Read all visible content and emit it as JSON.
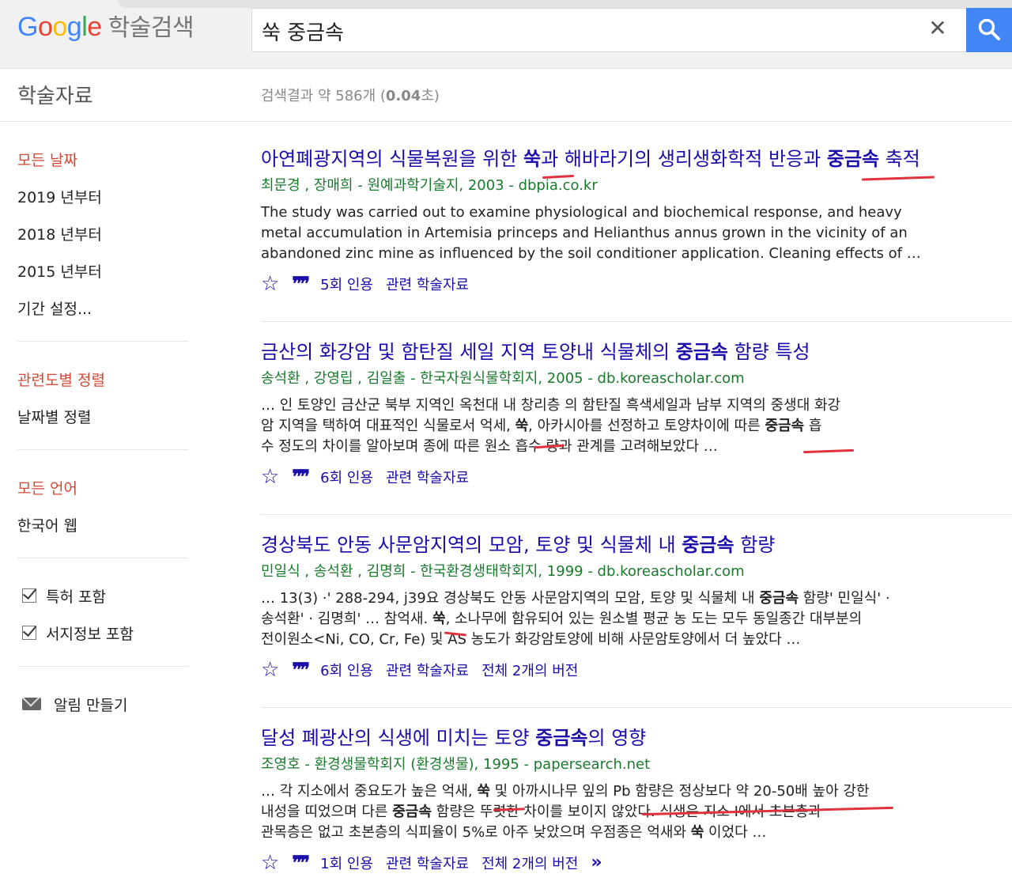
{
  "header": {
    "logo_letters": [
      "G",
      "o",
      "o",
      "g",
      "l",
      "e"
    ],
    "logo_suffix": "학술검색",
    "query": "쑥 중금속",
    "clear_icon": "✕",
    "search_icon": "search-icon"
  },
  "subbar": {
    "section_title": "학술자료",
    "stats_prefix": "검색결과 약 586개 (",
    "stats_time": "0.04",
    "stats_suffix": "초)"
  },
  "sidebar": {
    "date_filters": [
      "모든 날짜",
      "2019 년부터",
      "2018 년부터",
      "2015 년부터",
      "기간 설정..."
    ],
    "sort_options": [
      "관련도별 정렬",
      "날짜별 정렬"
    ],
    "language_options": [
      "모든 언어",
      "한국어 웹"
    ],
    "checkboxes": [
      "특허 포함",
      "서지정보 포함"
    ],
    "alert_label": "알림 만들기"
  },
  "results": [
    {
      "title": [
        {
          "t": "아연폐광지역의 식물복원을 위한 ",
          "b": false
        },
        {
          "t": "쑥",
          "b": true
        },
        {
          "t": "과 해바라기의 생리생화학적 반응과 ",
          "b": false
        },
        {
          "t": "중금속",
          "b": true
        },
        {
          "t": " 축적",
          "b": false
        }
      ],
      "meta": "최문경 ,  장매희 - 원예과학기술지, 2003 - dbpia.co.kr",
      "snippet": [
        [
          {
            "t": "The study was carried out to examine physiological and biochemical response, and heavy",
            "b": false
          }
        ],
        [
          {
            "t": "metal accumulation in Artemisia princeps and Helianthus annus grown in the vicinity of an",
            "b": false
          }
        ],
        [
          {
            "t": "abandoned zinc mine as influenced by the soil conditioner application. Cleaning effects of …",
            "b": false
          }
        ]
      ],
      "citations": "5회 인용",
      "related": "관련 학술자료",
      "versions": ""
    },
    {
      "title": [
        {
          "t": "금산의 화강암 및 함탄질 세일 지역 토양내 식물체의 ",
          "b": false
        },
        {
          "t": "중금속",
          "b": true
        },
        {
          "t": " 함량 특성",
          "b": false
        }
      ],
      "meta": "송석환 ,  강영립 ,  김일출 - 한국자원식물학회지, 2005 - db.koreascholar.com",
      "snippet": [
        [
          {
            "t": "… 인 토양인 금산군 북부 지역인 옥천대 내 창리층 의 함탄질 흑색세일과 남부 지역의 중생대 화강",
            "b": false
          }
        ],
        [
          {
            "t": "암 지역을 택하여 대표적인 식물로서 억세, ",
            "b": false
          },
          {
            "t": "쑥",
            "b": true
          },
          {
            "t": ", 아카시아를 선정하고 토양차이에 따른 ",
            "b": false
          },
          {
            "t": "중금속",
            "b": true
          },
          {
            "t": " 흡",
            "b": false
          }
        ],
        [
          {
            "t": "수 정도의 차이를 알아보며 종에 따른 원소 흡수 량과 관계를 고려해보았다 …",
            "b": false
          }
        ]
      ],
      "citations": "6회 인용",
      "related": "관련 학술자료",
      "versions": ""
    },
    {
      "title": [
        {
          "t": "경상북도 안동 사문암지역의 모암, 토양 및 식물체 내 ",
          "b": false
        },
        {
          "t": "중금속",
          "b": true
        },
        {
          "t": " 함량",
          "b": false
        }
      ],
      "meta": "민일식 ,  송석환 ,  김명희 - 한국환경생태학회지, 1999 - db.koreascholar.com",
      "snippet": [
        [
          {
            "t": "… 13(3) ·' 288-294, j39요 경상북도 안동 사문암지역의 모암, 토양 및 식물체 내 ",
            "b": false
          },
          {
            "t": "중금속",
            "b": true
          },
          {
            "t": " 함량' 민일식' ·",
            "b": false
          }
        ],
        [
          {
            "t": "송석환' · 김명희' … 참억새. ",
            "b": false
          },
          {
            "t": "쑥",
            "b": true
          },
          {
            "t": ", 소나무에 함유되어 있는 원소별 평균 농 도는 모두 동일종간 대부분의",
            "b": false
          }
        ],
        [
          {
            "t": "전이원소<Ni, CO, Cr, Fe) 및 AS 농도가 화강암토양에 비해 사문암토양에서 더 높았다 …",
            "b": false
          }
        ]
      ],
      "citations": "6회 인용",
      "related": "관련 학술자료",
      "versions": "전체 2개의 버전"
    },
    {
      "title": [
        {
          "t": "달성 폐광산의 식생에 미치는 토양 ",
          "b": false
        },
        {
          "t": "중금속",
          "b": true
        },
        {
          "t": "의 영향",
          "b": false
        }
      ],
      "meta": "조영호 - 환경생물학회지 (환경생물), 1995 - papersearch.net",
      "snippet": [
        [
          {
            "t": "… 각 지소에서 중요도가 높은 억새, ",
            "b": false
          },
          {
            "t": "쑥",
            "b": true
          },
          {
            "t": " 및 아까시나무 잎의 Pb 함량은 정상보다 약 20-50배 높아 강한",
            "b": false
          }
        ],
        [
          {
            "t": "내성을 띠었으며 다른 ",
            "b": false
          },
          {
            "t": "중금속",
            "b": true
          },
          {
            "t": " 함량은 뚜렷한 차이를 보이지 않았다. 식생은 지소 I에서 초본층과",
            "b": false
          }
        ],
        [
          {
            "t": "관목층은 없고 초본층의 식피율이 5%로 아주 낮았으며 우점종은 억새와 ",
            "b": false
          },
          {
            "t": "쑥",
            "b": true
          },
          {
            "t": " 이었다 …",
            "b": false
          }
        ]
      ],
      "citations": "1회 인용",
      "related": "관련 학술자료",
      "versions": "전체 2개의 버전",
      "more": "»"
    }
  ],
  "colors": {
    "link": "#1a0dab",
    "meta_green": "#1a7a2c",
    "active_filter": "#d14836",
    "search_button": "#4285f4",
    "annotation_red": "#e0333d"
  }
}
